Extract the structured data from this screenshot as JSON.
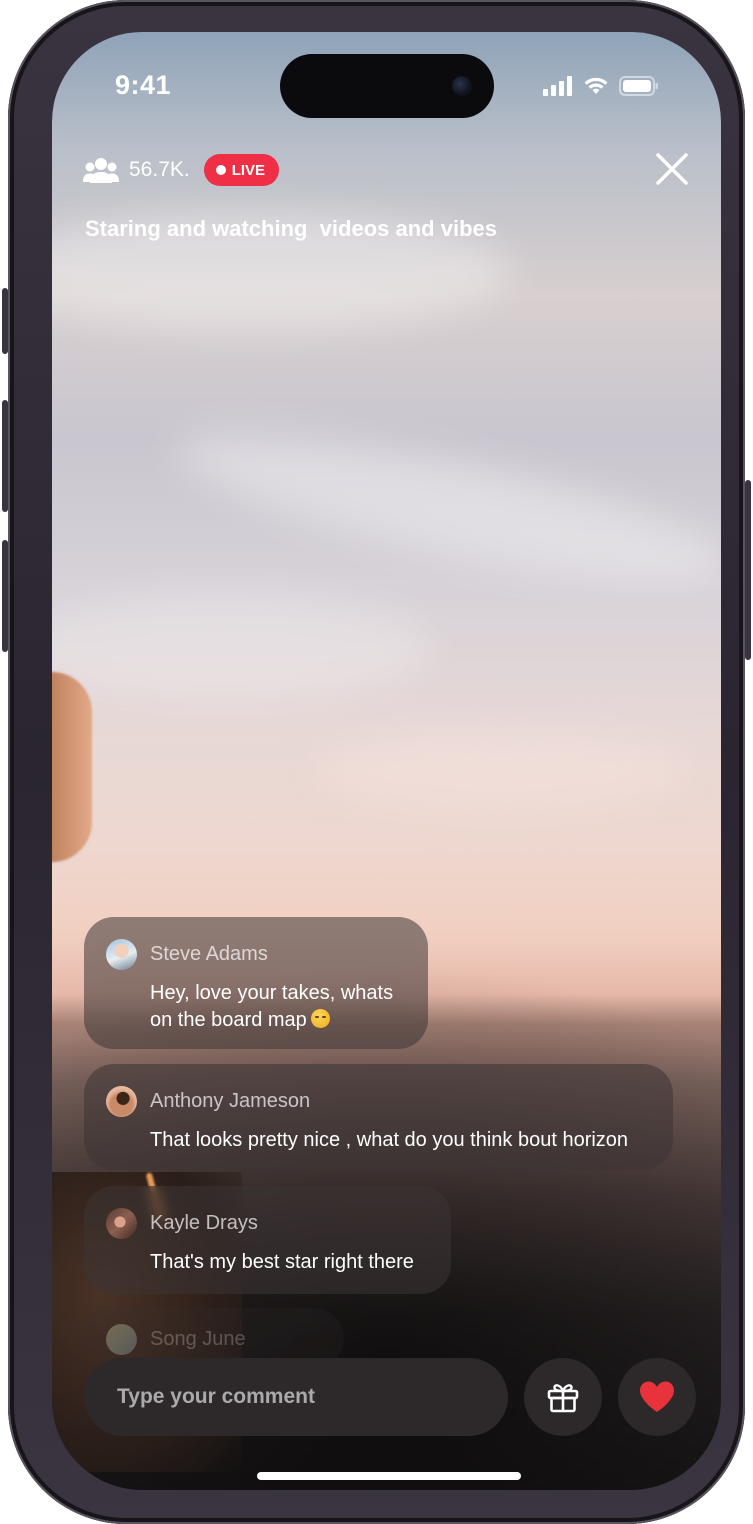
{
  "status_bar": {
    "time": "9:41",
    "icons": [
      "cellular-signal-icon",
      "wifi-icon",
      "battery-icon"
    ]
  },
  "header": {
    "viewer_icon": "people-icon",
    "viewer_count": "56.7K.",
    "live_label": "LIVE",
    "live_color": "#ef2f45",
    "close_icon": "close-icon",
    "title": "Staring and watching  videos and vibes"
  },
  "comments": [
    {
      "name": "Steve Adams",
      "text_line1": "Hey, love your takes, whats",
      "text_line2": "on the board map",
      "emoji": "relieved-face-emoji"
    },
    {
      "name": "Anthony Jameson",
      "text": "That looks pretty nice , what do you think bout horizon"
    },
    {
      "name": "Kayle Drays",
      "text": "That's my best star right there"
    },
    {
      "name": "Song June",
      "text": ""
    }
  ],
  "composer": {
    "placeholder": "Type your comment",
    "gift_icon": "gift-icon",
    "heart_icon": "heart-icon",
    "heart_color": "#e8333c"
  }
}
